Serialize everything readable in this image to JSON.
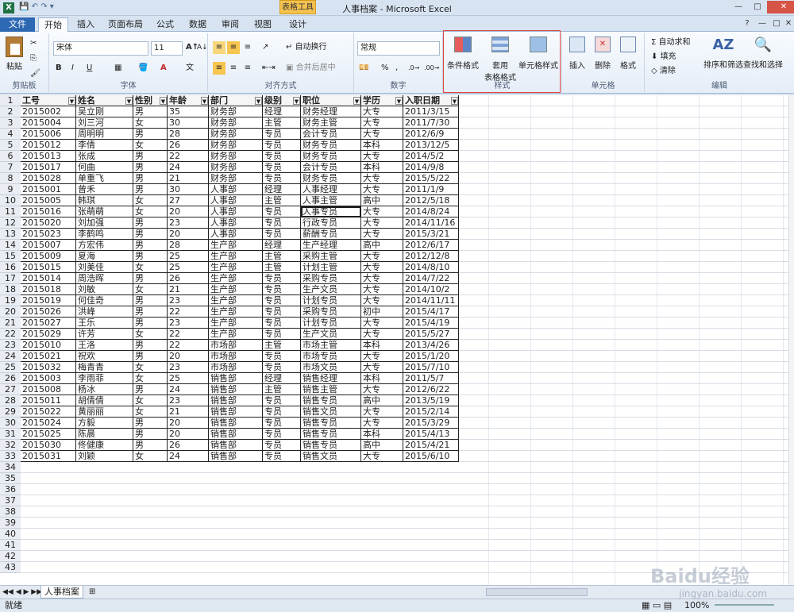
{
  "app": {
    "title": "人事档案 - Microsoft Excel",
    "tool_tab": "表格工具",
    "tabs": [
      "文件",
      "开始",
      "插入",
      "页面布局",
      "公式",
      "数据",
      "审阅",
      "视图",
      "设计"
    ]
  },
  "ribbon": {
    "clipboard": {
      "paste": "粘贴",
      "group": "剪贴板"
    },
    "font": {
      "name": "宋体",
      "size": "11",
      "group": "字体"
    },
    "alignment": {
      "wrap": "自动换行",
      "merge": "合并后居中",
      "group": "对齐方式"
    },
    "number": {
      "format": "常规",
      "percent": "%",
      "group": "数字"
    },
    "styles": {
      "conditional": "条件格式",
      "table_line1": "套用",
      "table_line2": "表格格式",
      "cell_styles": "单元格样式",
      "group": "样式"
    },
    "cells": {
      "insert": "插入",
      "delete": "删除",
      "format": "格式",
      "group": "单元格"
    },
    "editing": {
      "autosum": "Σ 自动求和",
      "fill": "填充",
      "clear": "清除",
      "sort": "排序和筛选",
      "find": "查找和选择",
      "group": "编辑"
    }
  },
  "sheet": {
    "headers": [
      "工号",
      "姓名",
      "性别",
      "年龄",
      "部门",
      "级别",
      "职位",
      "学历",
      "入职日期"
    ],
    "rows": [
      [
        "2015002",
        "吴立刚",
        "男",
        "35",
        "财务部",
        "经理",
        "财务经理",
        "大专",
        "2011/3/15"
      ],
      [
        "2015004",
        "刘三河",
        "女",
        "30",
        "财务部",
        "主管",
        "财务主管",
        "大专",
        "2011/7/30"
      ],
      [
        "2015006",
        "周明明",
        "男",
        "28",
        "财务部",
        "专员",
        "会计专员",
        "大专",
        "2012/6/9"
      ],
      [
        "2015012",
        "李倩",
        "女",
        "26",
        "财务部",
        "专员",
        "财务专员",
        "本科",
        "2013/12/5"
      ],
      [
        "2015013",
        "张成",
        "男",
        "22",
        "财务部",
        "专员",
        "财务专员",
        "大专",
        "2014/5/2"
      ],
      [
        "2015017",
        "何曲",
        "男",
        "24",
        "财务部",
        "专员",
        "会计专员",
        "本科",
        "2014/9/8"
      ],
      [
        "2015028",
        "单重飞",
        "男",
        "21",
        "财务部",
        "专员",
        "财务专员",
        "大专",
        "2015/5/22"
      ],
      [
        "2015001",
        "曾禾",
        "男",
        "30",
        "人事部",
        "经理",
        "人事经理",
        "大专",
        "2011/1/9"
      ],
      [
        "2015005",
        "韩琪",
        "女",
        "27",
        "人事部",
        "主管",
        "人事主管",
        "高中",
        "2012/5/18"
      ],
      [
        "2015016",
        "张萌萌",
        "女",
        "20",
        "人事部",
        "专员",
        "人事专员",
        "大专",
        "2014/8/24"
      ],
      [
        "2015020",
        "刘加强",
        "男",
        "23",
        "人事部",
        "专员",
        "行政专员",
        "大专",
        "2014/11/16"
      ],
      [
        "2015023",
        "李鹤鸣",
        "男",
        "20",
        "人事部",
        "专员",
        "薪酬专员",
        "大专",
        "2015/3/21"
      ],
      [
        "2015007",
        "方宏伟",
        "男",
        "28",
        "生产部",
        "经理",
        "生产经理",
        "高中",
        "2012/6/17"
      ],
      [
        "2015009",
        "夏海",
        "男",
        "25",
        "生产部",
        "主管",
        "采购主管",
        "大专",
        "2012/12/8"
      ],
      [
        "2015015",
        "刘美佳",
        "女",
        "25",
        "生产部",
        "主管",
        "计划主管",
        "大专",
        "2014/8/10"
      ],
      [
        "2015014",
        "周浩晖",
        "男",
        "26",
        "生产部",
        "专员",
        "采购专员",
        "大专",
        "2014/7/22"
      ],
      [
        "2015018",
        "刘敏",
        "女",
        "21",
        "生产部",
        "专员",
        "生产文员",
        "大专",
        "2014/10/2"
      ],
      [
        "2015019",
        "何佳奇",
        "男",
        "23",
        "生产部",
        "专员",
        "计划专员",
        "大专",
        "2014/11/11"
      ],
      [
        "2015026",
        "洪峰",
        "男",
        "22",
        "生产部",
        "专员",
        "采购专员",
        "初中",
        "2015/4/17"
      ],
      [
        "2015027",
        "王乐",
        "男",
        "23",
        "生产部",
        "专员",
        "计划专员",
        "大专",
        "2015/4/19"
      ],
      [
        "2015029",
        "许芳",
        "女",
        "22",
        "生产部",
        "专员",
        "生产文员",
        "大专",
        "2015/5/27"
      ],
      [
        "2015010",
        "王洛",
        "男",
        "22",
        "市场部",
        "主管",
        "市场主管",
        "本科",
        "2013/4/26"
      ],
      [
        "2015021",
        "祝欢",
        "男",
        "20",
        "市场部",
        "专员",
        "市场专员",
        "大专",
        "2015/1/20"
      ],
      [
        "2015032",
        "梅青青",
        "女",
        "23",
        "市场部",
        "专员",
        "市场文员",
        "大专",
        "2015/7/10"
      ],
      [
        "2015003",
        "李雨菲",
        "女",
        "25",
        "销售部",
        "经理",
        "销售经理",
        "本科",
        "2011/5/7"
      ],
      [
        "2015008",
        "杨冰",
        "男",
        "24",
        "销售部",
        "主管",
        "销售主管",
        "大专",
        "2012/6/22"
      ],
      [
        "2015011",
        "胡倩倩",
        "女",
        "23",
        "销售部",
        "专员",
        "销售专员",
        "高中",
        "2013/5/19"
      ],
      [
        "2015022",
        "黄丽丽",
        "女",
        "21",
        "销售部",
        "专员",
        "销售文员",
        "大专",
        "2015/2/14"
      ],
      [
        "2015024",
        "方毅",
        "男",
        "20",
        "销售部",
        "专员",
        "销售专员",
        "大专",
        "2015/3/29"
      ],
      [
        "2015025",
        "陈晨",
        "男",
        "20",
        "销售部",
        "专员",
        "销售专员",
        "本科",
        "2015/4/13"
      ],
      [
        "2015030",
        "佟健康",
        "男",
        "26",
        "销售部",
        "专员",
        "销售专员",
        "高中",
        "2015/4/21"
      ],
      [
        "2015031",
        "刘颖",
        "女",
        "24",
        "销售部",
        "专员",
        "销售文员",
        "大专",
        "2015/6/10"
      ]
    ],
    "row_numbers": [
      "1",
      "2",
      "3",
      "4",
      "5",
      "6",
      "7",
      "8",
      "9",
      "10",
      "11",
      "12",
      "13",
      "14",
      "15",
      "16",
      "17",
      "18",
      "19",
      "20",
      "21",
      "22",
      "23",
      "24",
      "25",
      "26",
      "27",
      "28",
      "29",
      "30",
      "31",
      "32",
      "33",
      "34",
      "35",
      "36",
      "37",
      "38",
      "39",
      "40",
      "41",
      "42",
      "43"
    ],
    "tab_name": "人事档案",
    "status": "就绪",
    "zoom": "100%"
  },
  "watermark": {
    "brand": "Baidu经验",
    "url": "jingyan.baidu.com"
  }
}
